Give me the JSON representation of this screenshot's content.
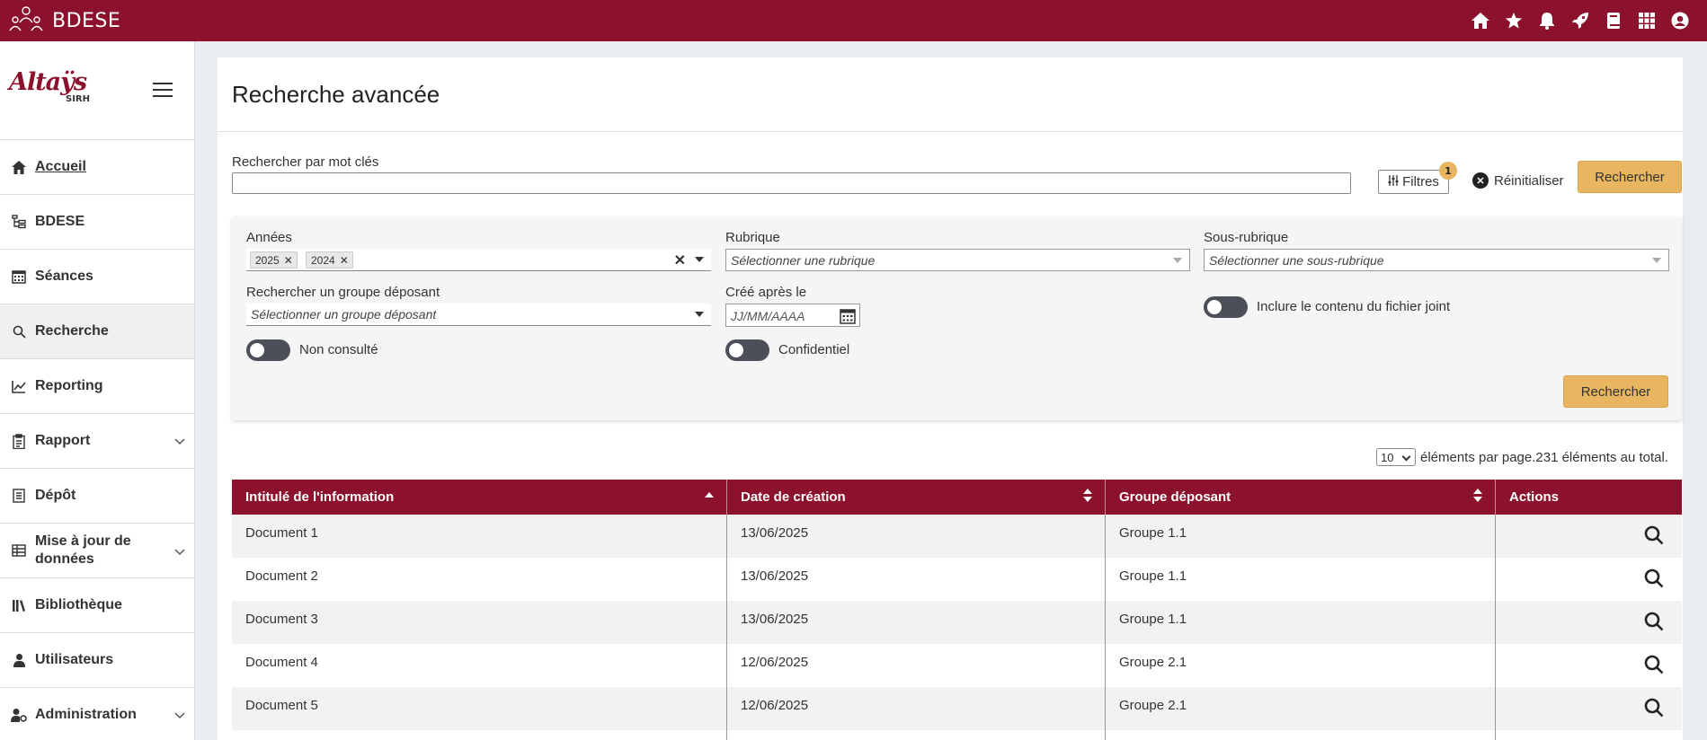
{
  "topbar": {
    "app_name": "BDESE",
    "icons": [
      "home-icon",
      "star-icon",
      "bell-icon",
      "rocket-icon",
      "book-icon",
      "apps-grid-icon",
      "user-icon"
    ],
    "color": "#8c112d"
  },
  "sidebar": {
    "logo_text": "Altaÿs",
    "logo_sub": "SIRH",
    "items": [
      {
        "label": "Accueil",
        "icon": "home-icon"
      },
      {
        "label": "BDESE",
        "icon": "tree-icon"
      },
      {
        "label": "Séances",
        "icon": "calendar-icon"
      },
      {
        "label": "Recherche",
        "icon": "search-icon"
      },
      {
        "label": "Reporting",
        "icon": "chart-line-icon"
      },
      {
        "label": "Rapport",
        "icon": "clipboard-icon"
      },
      {
        "label": "Dépôt",
        "icon": "document-icon"
      },
      {
        "label": "Mise à jour de",
        "label2": "données",
        "icon": "table-icon"
      },
      {
        "label": "Bibliothèque",
        "icon": "books-icon"
      },
      {
        "label": "Utilisateurs",
        "icon": "user-tie-icon"
      },
      {
        "label": "Administration",
        "icon": "user-gear-icon"
      }
    ]
  },
  "main": {
    "title": "Recherche avancée",
    "search_label": "Rechercher par mot clés",
    "search_value": "",
    "filters_button": "Filtres",
    "filters_badge": "1",
    "reset_label": "Réinitialiser",
    "search_button": "Rechercher"
  },
  "filters": {
    "annees_label": "Années",
    "annees_tags": [
      "2025",
      "2024"
    ],
    "rubrique_label": "Rubrique",
    "rubrique_placeholder": "Sélectionner une rubrique",
    "sous_rubrique_label": "Sous-rubrique",
    "sous_rubrique_placeholder": "Sélectionner une sous-rubrique",
    "groupe_label": "Rechercher un groupe déposant",
    "groupe_placeholder": "Sélectionner un groupe déposant",
    "cree_label": "Créé après le",
    "cree_placeholder": "JJ/MM/AAAA",
    "fichier_label": "Inclure le contenu du fichier joint",
    "non_consulte_label": "Non consulté",
    "confidentiel_label": "Confidentiel",
    "search_button": "Rechercher"
  },
  "pagination": {
    "page_size": "10",
    "text": "éléments par page.231 éléments au total."
  },
  "table": {
    "headers": [
      "Intitulé de l'information",
      "Date de création",
      "Groupe déposant",
      "Actions"
    ],
    "rows": [
      {
        "title": "Document 1",
        "date": "13/06/2025",
        "group": "Groupe 1.1"
      },
      {
        "title": "Document 2",
        "date": "13/06/2025",
        "group": "Groupe 1.1"
      },
      {
        "title": "Document 3",
        "date": "13/06/2025",
        "group": "Groupe 1.1"
      },
      {
        "title": "Document 4",
        "date": "12/06/2025",
        "group": "Groupe 2.1"
      },
      {
        "title": "Document 5",
        "date": "12/06/2025",
        "group": "Groupe 2.1"
      },
      {
        "title": "",
        "date": "",
        "group": ""
      }
    ]
  }
}
